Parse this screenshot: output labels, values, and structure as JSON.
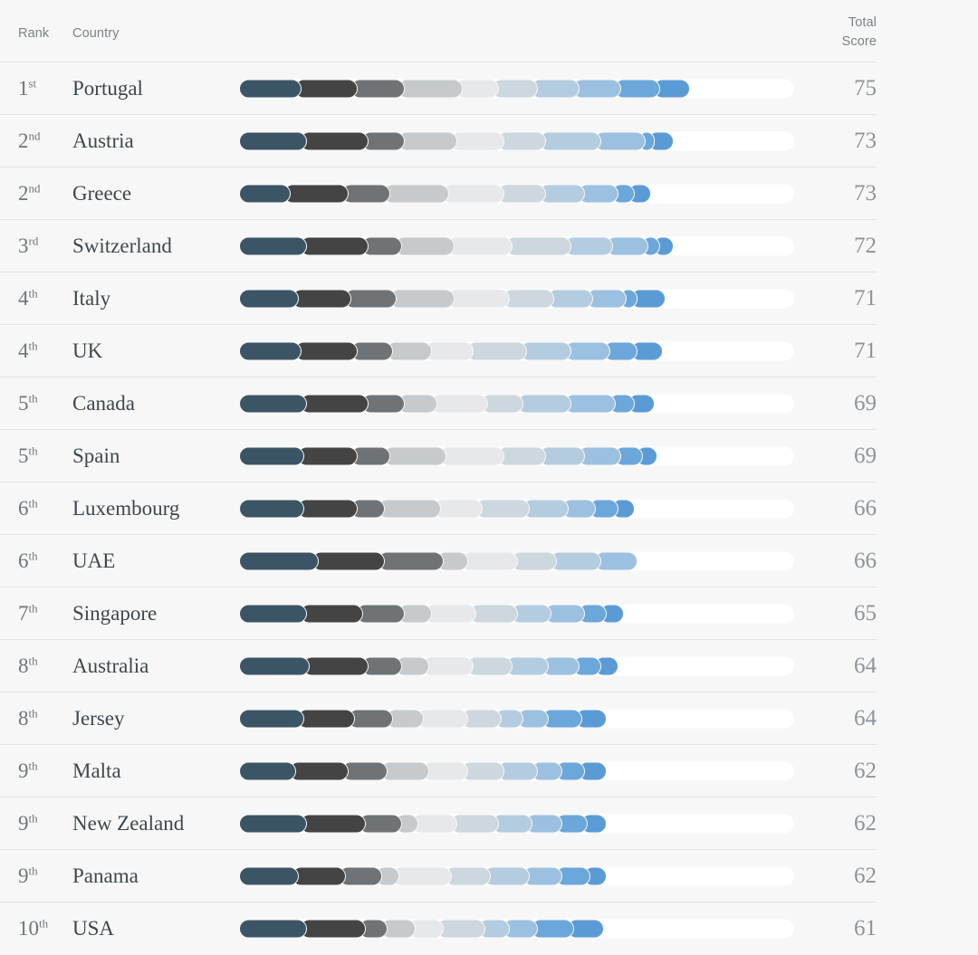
{
  "header": {
    "rank_label": "Rank",
    "country_label": "Country",
    "score_label_line1": "Total",
    "score_label_line2": "Score"
  },
  "palette": {
    "background": "#f7f7f7",
    "track": "#ffffff",
    "divider": "#e3e4e5",
    "header_text": "#7b8286",
    "country_text": "#3f474d",
    "rank_text": "#6f767a",
    "score_text": "#8e9499",
    "segment_colors": [
      "#3c5566",
      "#444444",
      "#6f7376",
      "#c6cacd",
      "#e7e8ea",
      "#ccd7de",
      "#b4cce0",
      "#9cc1e0",
      "#6ba7da",
      "#5b9bd5"
    ]
  },
  "chart_data": {
    "type": "bar",
    "title": "",
    "xlabel": "",
    "ylabel": "Total Score",
    "scale_max": 100,
    "columns": [
      "Rank",
      "Country",
      "Total Score"
    ],
    "categories": [
      "Portugal",
      "Austria",
      "Greece",
      "Switzerland",
      "Italy",
      "UK",
      "Canada",
      "Spain",
      "Luxembourg",
      "UAE",
      "Singapore",
      "Australia",
      "Jersey",
      "Malta",
      "New Zealand",
      "Panama",
      "USA"
    ],
    "values": [
      75,
      73,
      73,
      72,
      71,
      71,
      69,
      69,
      66,
      66,
      65,
      64,
      64,
      62,
      62,
      62,
      61
    ],
    "rows": [
      {
        "rank": "1",
        "ordinal": "st",
        "country": "Portugal",
        "score": 75,
        "segments": [
          10.0,
          10.0,
          8.5,
          10.5,
          6.5,
          7.0,
          7.5,
          7.5,
          7.0,
          5.5
        ]
      },
      {
        "rank": "2",
        "ordinal": "nd",
        "country": "Austria",
        "score": 73,
        "segments": [
          11.0,
          11.0,
          6.5,
          9.5,
          8.5,
          7.5,
          10.0,
          8.0,
          1.5,
          3.5
        ]
      },
      {
        "rank": "2",
        "ordinal": "nd",
        "country": "Greece",
        "score": 73,
        "segments": [
          8.0,
          10.5,
          7.5,
          10.5,
          10.0,
          7.5,
          7.0,
          6.0,
          3.0,
          3.0
        ]
      },
      {
        "rank": "3",
        "ordinal": "rd",
        "country": "Switzerland",
        "score": 72,
        "segments": [
          11.0,
          11.0,
          6.0,
          9.5,
          10.5,
          10.5,
          7.5,
          6.5,
          2.0,
          2.5
        ]
      },
      {
        "rank": "4",
        "ordinal": "th",
        "country": "Italy",
        "score": 71,
        "segments": [
          9.5,
          9.5,
          8.0,
          10.5,
          10.0,
          8.0,
          7.0,
          6.0,
          2.0,
          5.0
        ]
      },
      {
        "rank": "4",
        "ordinal": "th",
        "country": "UK",
        "score": 71,
        "segments": [
          10.0,
          10.0,
          6.5,
          7.0,
          7.5,
          9.5,
          8.0,
          7.0,
          5.0,
          4.5
        ]
      },
      {
        "rank": "5",
        "ordinal": "th",
        "country": "Canada",
        "score": 69,
        "segments": [
          11.0,
          11.0,
          6.5,
          6.0,
          9.0,
          6.5,
          8.5,
          8.0,
          3.5,
          3.5
        ]
      },
      {
        "rank": "5",
        "ordinal": "th",
        "country": "Spain",
        "score": 69,
        "segments": [
          10.5,
          9.5,
          6.0,
          10.0,
          10.5,
          7.5,
          7.0,
          6.5,
          4.0,
          2.5
        ]
      },
      {
        "rank": "6",
        "ordinal": "th",
        "country": "Luxembourg",
        "score": 66,
        "segments": [
          10.5,
          9.5,
          5.0,
          10.0,
          7.5,
          8.5,
          7.0,
          5.0,
          4.0,
          3.0
        ]
      },
      {
        "rank": "6",
        "ordinal": "th",
        "country": "UAE",
        "score": 66,
        "segments": [
          13.0,
          12.0,
          10.5,
          4.5,
          9.0,
          7.0,
          8.0,
          6.5,
          0.0,
          0.0
        ]
      },
      {
        "rank": "7",
        "ordinal": "th",
        "country": "Singapore",
        "score": 65,
        "segments": [
          11.0,
          10.0,
          7.5,
          5.0,
          8.0,
          7.5,
          6.0,
          6.0,
          4.0,
          3.0
        ]
      },
      {
        "rank": "8",
        "ordinal": "th",
        "country": "Australia",
        "score": 64,
        "segments": [
          11.5,
          10.5,
          6.0,
          5.0,
          8.0,
          7.0,
          6.5,
          5.5,
          4.0,
          3.0
        ]
      },
      {
        "rank": "8",
        "ordinal": "th",
        "country": "Jersey",
        "score": 64,
        "segments": [
          10.5,
          9.0,
          7.0,
          5.5,
          8.0,
          6.0,
          4.0,
          4.5,
          6.0,
          4.5
        ]
      },
      {
        "rank": "9",
        "ordinal": "th",
        "country": "Malta",
        "score": 62,
        "segments": [
          9.0,
          9.5,
          7.0,
          7.5,
          7.0,
          6.5,
          6.0,
          4.5,
          4.0,
          4.0
        ]
      },
      {
        "rank": "9",
        "ordinal": "th",
        "country": "New Zealand",
        "score": 62,
        "segments": [
          11.0,
          10.5,
          6.5,
          3.0,
          7.0,
          7.5,
          6.0,
          5.5,
          4.5,
          3.5
        ]
      },
      {
        "rank": "9",
        "ordinal": "th",
        "country": "Panama",
        "score": 62,
        "segments": [
          9.5,
          8.5,
          6.5,
          3.0,
          9.5,
          7.0,
          7.0,
          6.0,
          5.0,
          3.0
        ]
      },
      {
        "rank": "10",
        "ordinal": "th",
        "country": "USA",
        "score": 61,
        "segments": [
          11.0,
          10.5,
          4.0,
          5.0,
          5.0,
          7.5,
          4.5,
          5.0,
          6.5,
          5.5
        ]
      }
    ]
  }
}
